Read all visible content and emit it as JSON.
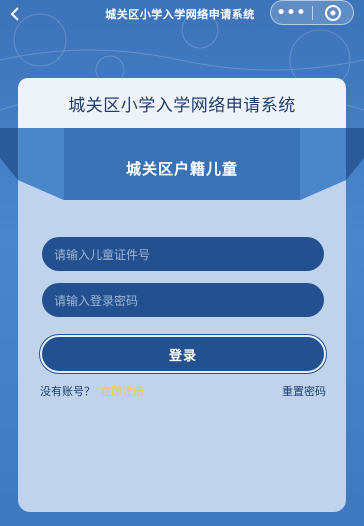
{
  "nav": {
    "title": "城关区小学入学网络申请系统",
    "back_icon": "chevron-left-icon",
    "more_icon": "more-dots-icon",
    "close_icon": "target-close-icon",
    "more_label": "•••"
  },
  "header": {
    "system_title": "城关区小学入学网络申请系统"
  },
  "form": {
    "section_title": "城关区户籍儿童",
    "id_placeholder": "请输入儿童证件号",
    "password_placeholder": "请输入登录密码",
    "login_label": "登录",
    "no_account_label": "没有账号？",
    "register_label": "立即注册",
    "reset_password_label": "重置密码"
  },
  "colors": {
    "background": "#3f78be",
    "panel": "#bfd3ec",
    "input": "#23508f",
    "ribbon": "#3a73b5",
    "link_accent": "#f2c94c",
    "text_dark": "#1f3e6e"
  }
}
